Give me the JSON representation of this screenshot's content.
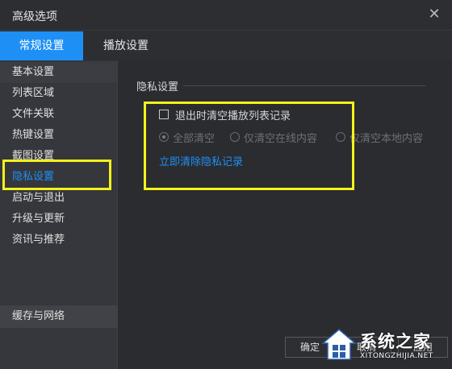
{
  "window": {
    "title": "高级选项",
    "close_glyph": "✕"
  },
  "tabs": [
    {
      "label": "常规设置",
      "active": true
    },
    {
      "label": "播放设置",
      "active": false
    }
  ],
  "sidebar": {
    "items": [
      {
        "label": "基本设置"
      },
      {
        "label": "列表区域"
      },
      {
        "label": "文件关联"
      },
      {
        "label": "热键设置"
      },
      {
        "label": "截图设置"
      },
      {
        "label": "隐私设置",
        "active": true
      },
      {
        "label": "启动与退出"
      },
      {
        "label": "升级与更新"
      },
      {
        "label": "资讯与推荐"
      }
    ],
    "bottom_item": "缓存与网络"
  },
  "privacy": {
    "section_title": "隐私设置",
    "checkbox_label": "退出时清空播放列表记录",
    "checkbox_checked": false,
    "radio_options": [
      {
        "label": "全部清空",
        "selected": true
      },
      {
        "label": "仅清空在线内容",
        "selected": false
      },
      {
        "label": "仅清空本地内容",
        "selected": false
      }
    ],
    "clear_link": "立即清除隐私记录"
  },
  "buttons": {
    "ok": "确定",
    "cancel": "取消",
    "apply": "应用"
  },
  "watermark": {
    "title": "系统之家",
    "url": "XITONGZHIJIA.NET"
  },
  "colors": {
    "accent": "#1e90f5",
    "highlight": "#f5f21a",
    "background": "#2b2c30",
    "sidebar": "#35373c"
  }
}
